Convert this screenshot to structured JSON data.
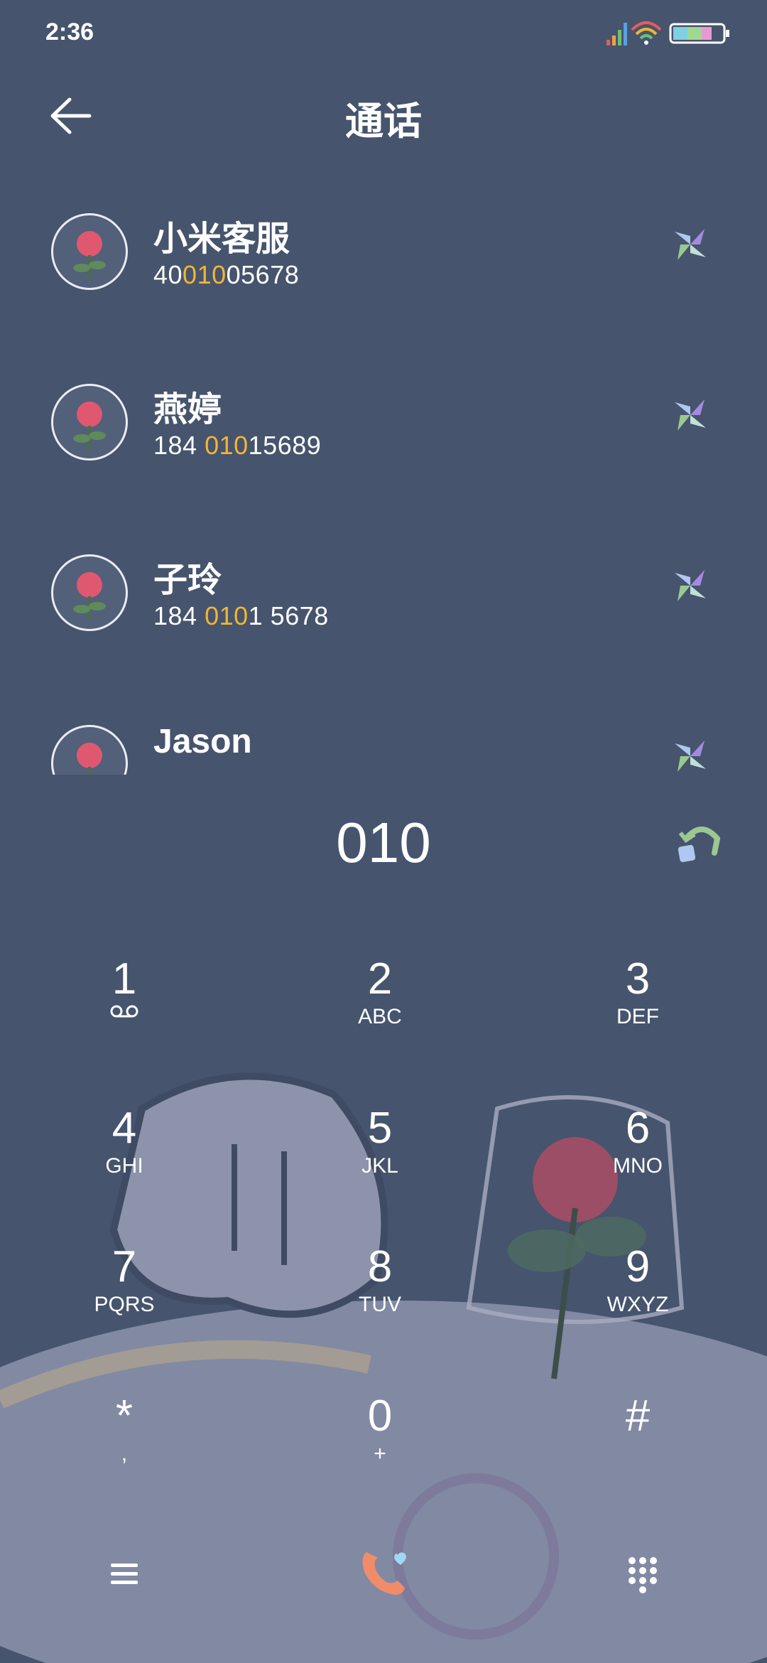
{
  "status_bar": {
    "time": "2:36"
  },
  "header": {
    "title": "通话"
  },
  "contacts": [
    {
      "name": "小米客服",
      "number_parts": [
        "40",
        "010",
        "05678"
      ]
    },
    {
      "name": "燕婷",
      "number_parts": [
        "184 ",
        "010",
        "15689"
      ]
    },
    {
      "name": "子玲",
      "number_parts": [
        "184 ",
        "010",
        "1 5678"
      ]
    },
    {
      "name": "Jason",
      "number_parts": [
        "",
        "",
        ""
      ]
    }
  ],
  "dialer": {
    "input": "010"
  },
  "keypad": [
    {
      "num": "1",
      "letters": ""
    },
    {
      "num": "2",
      "letters": "ABC"
    },
    {
      "num": "3",
      "letters": "DEF"
    },
    {
      "num": "4",
      "letters": "GHI"
    },
    {
      "num": "5",
      "letters": "JKL"
    },
    {
      "num": "6",
      "letters": "MNO"
    },
    {
      "num": "7",
      "letters": "PQRS"
    },
    {
      "num": "8",
      "letters": "TUV"
    },
    {
      "num": "9",
      "letters": "WXYZ"
    },
    {
      "num": "*",
      "letters": ","
    },
    {
      "num": "0",
      "letters": "+"
    },
    {
      "num": "#",
      "letters": ""
    }
  ],
  "colors": {
    "background": "#46546e",
    "highlight": "#f0b632",
    "text": "#ffffff"
  },
  "icons": {
    "back": "arrow-left-icon",
    "call": "pinwheel-call-icon",
    "backspace": "backspace-arrow-icon",
    "voicemail": "voicemail-icon",
    "menu": "hamburger-menu-icon",
    "dial": "phone-heart-icon",
    "keypad_toggle": "dialpad-grid-icon"
  }
}
